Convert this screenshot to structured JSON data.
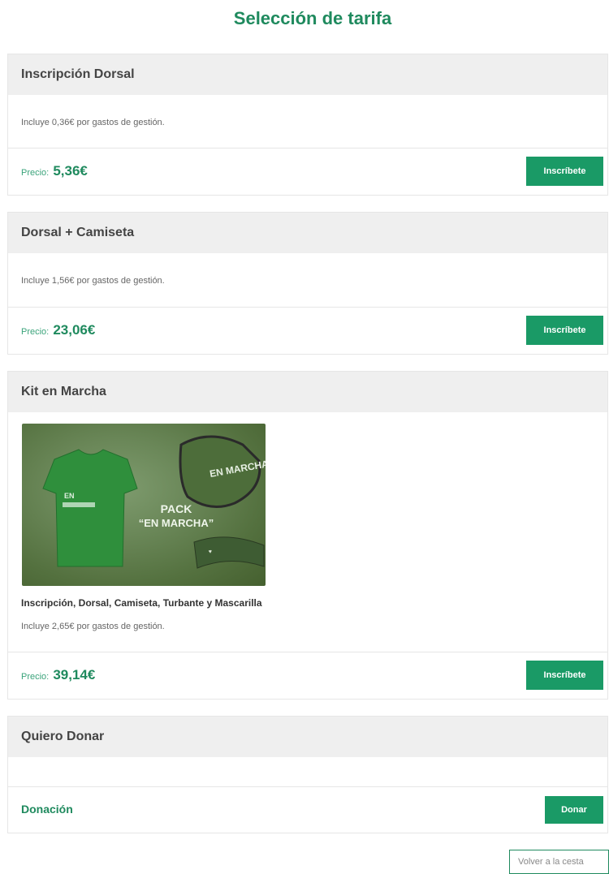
{
  "page": {
    "title": "Selección de tarifa"
  },
  "price_label": "Precio:",
  "fares": [
    {
      "name": "Inscripción Dorsal",
      "fee_note": "Incluye 0,36€ por gastos de gestión.",
      "price": "5,36€",
      "button": "Inscríbete"
    },
    {
      "name": "Dorsal + Camiseta",
      "fee_note": "Incluye 1,56€ por gastos de gestión.",
      "price": "23,06€",
      "button": "Inscríbete"
    },
    {
      "name": "Kit en Marcha",
      "image": {
        "line1": "PACK",
        "line2": "“EN MARCHA”",
        "mask_text": "EN MARCHA",
        "shirt_text": "EN"
      },
      "description": "Inscripción, Dorsal, Camiseta, Turbante y Mascarilla",
      "fee_note": "Incluye 2,65€ por gastos de gestión.",
      "price": "39,14€",
      "button": "Inscríbete"
    }
  ],
  "donation": {
    "name": "Quiero Donar",
    "label": "Donación",
    "button": "Donar"
  },
  "back_button": "Volver a la cesta",
  "colors": {
    "accent": "#1f8a5e",
    "button": "#1a9a66",
    "header_bg": "#efefef"
  }
}
